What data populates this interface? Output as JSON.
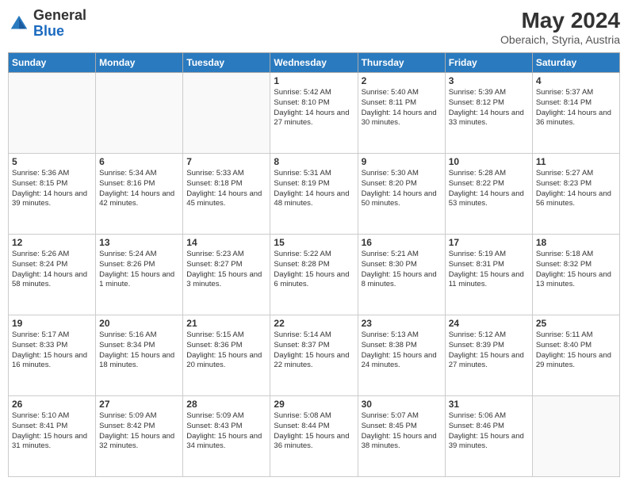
{
  "header": {
    "logo_general": "General",
    "logo_blue": "Blue",
    "month_year": "May 2024",
    "location": "Oberaich, Styria, Austria"
  },
  "days_of_week": [
    "Sunday",
    "Monday",
    "Tuesday",
    "Wednesday",
    "Thursday",
    "Friday",
    "Saturday"
  ],
  "weeks": [
    [
      {
        "day": "",
        "info": ""
      },
      {
        "day": "",
        "info": ""
      },
      {
        "day": "",
        "info": ""
      },
      {
        "day": "1",
        "info": "Sunrise: 5:42 AM\nSunset: 8:10 PM\nDaylight: 14 hours\nand 27 minutes."
      },
      {
        "day": "2",
        "info": "Sunrise: 5:40 AM\nSunset: 8:11 PM\nDaylight: 14 hours\nand 30 minutes."
      },
      {
        "day": "3",
        "info": "Sunrise: 5:39 AM\nSunset: 8:12 PM\nDaylight: 14 hours\nand 33 minutes."
      },
      {
        "day": "4",
        "info": "Sunrise: 5:37 AM\nSunset: 8:14 PM\nDaylight: 14 hours\nand 36 minutes."
      }
    ],
    [
      {
        "day": "5",
        "info": "Sunrise: 5:36 AM\nSunset: 8:15 PM\nDaylight: 14 hours\nand 39 minutes."
      },
      {
        "day": "6",
        "info": "Sunrise: 5:34 AM\nSunset: 8:16 PM\nDaylight: 14 hours\nand 42 minutes."
      },
      {
        "day": "7",
        "info": "Sunrise: 5:33 AM\nSunset: 8:18 PM\nDaylight: 14 hours\nand 45 minutes."
      },
      {
        "day": "8",
        "info": "Sunrise: 5:31 AM\nSunset: 8:19 PM\nDaylight: 14 hours\nand 48 minutes."
      },
      {
        "day": "9",
        "info": "Sunrise: 5:30 AM\nSunset: 8:20 PM\nDaylight: 14 hours\nand 50 minutes."
      },
      {
        "day": "10",
        "info": "Sunrise: 5:28 AM\nSunset: 8:22 PM\nDaylight: 14 hours\nand 53 minutes."
      },
      {
        "day": "11",
        "info": "Sunrise: 5:27 AM\nSunset: 8:23 PM\nDaylight: 14 hours\nand 56 minutes."
      }
    ],
    [
      {
        "day": "12",
        "info": "Sunrise: 5:26 AM\nSunset: 8:24 PM\nDaylight: 14 hours\nand 58 minutes."
      },
      {
        "day": "13",
        "info": "Sunrise: 5:24 AM\nSunset: 8:26 PM\nDaylight: 15 hours\nand 1 minute."
      },
      {
        "day": "14",
        "info": "Sunrise: 5:23 AM\nSunset: 8:27 PM\nDaylight: 15 hours\nand 3 minutes."
      },
      {
        "day": "15",
        "info": "Sunrise: 5:22 AM\nSunset: 8:28 PM\nDaylight: 15 hours\nand 6 minutes."
      },
      {
        "day": "16",
        "info": "Sunrise: 5:21 AM\nSunset: 8:30 PM\nDaylight: 15 hours\nand 8 minutes."
      },
      {
        "day": "17",
        "info": "Sunrise: 5:19 AM\nSunset: 8:31 PM\nDaylight: 15 hours\nand 11 minutes."
      },
      {
        "day": "18",
        "info": "Sunrise: 5:18 AM\nSunset: 8:32 PM\nDaylight: 15 hours\nand 13 minutes."
      }
    ],
    [
      {
        "day": "19",
        "info": "Sunrise: 5:17 AM\nSunset: 8:33 PM\nDaylight: 15 hours\nand 16 minutes."
      },
      {
        "day": "20",
        "info": "Sunrise: 5:16 AM\nSunset: 8:34 PM\nDaylight: 15 hours\nand 18 minutes."
      },
      {
        "day": "21",
        "info": "Sunrise: 5:15 AM\nSunset: 8:36 PM\nDaylight: 15 hours\nand 20 minutes."
      },
      {
        "day": "22",
        "info": "Sunrise: 5:14 AM\nSunset: 8:37 PM\nDaylight: 15 hours\nand 22 minutes."
      },
      {
        "day": "23",
        "info": "Sunrise: 5:13 AM\nSunset: 8:38 PM\nDaylight: 15 hours\nand 24 minutes."
      },
      {
        "day": "24",
        "info": "Sunrise: 5:12 AM\nSunset: 8:39 PM\nDaylight: 15 hours\nand 27 minutes."
      },
      {
        "day": "25",
        "info": "Sunrise: 5:11 AM\nSunset: 8:40 PM\nDaylight: 15 hours\nand 29 minutes."
      }
    ],
    [
      {
        "day": "26",
        "info": "Sunrise: 5:10 AM\nSunset: 8:41 PM\nDaylight: 15 hours\nand 31 minutes."
      },
      {
        "day": "27",
        "info": "Sunrise: 5:09 AM\nSunset: 8:42 PM\nDaylight: 15 hours\nand 32 minutes."
      },
      {
        "day": "28",
        "info": "Sunrise: 5:09 AM\nSunset: 8:43 PM\nDaylight: 15 hours\nand 34 minutes."
      },
      {
        "day": "29",
        "info": "Sunrise: 5:08 AM\nSunset: 8:44 PM\nDaylight: 15 hours\nand 36 minutes."
      },
      {
        "day": "30",
        "info": "Sunrise: 5:07 AM\nSunset: 8:45 PM\nDaylight: 15 hours\nand 38 minutes."
      },
      {
        "day": "31",
        "info": "Sunrise: 5:06 AM\nSunset: 8:46 PM\nDaylight: 15 hours\nand 39 minutes."
      },
      {
        "day": "",
        "info": ""
      }
    ]
  ]
}
